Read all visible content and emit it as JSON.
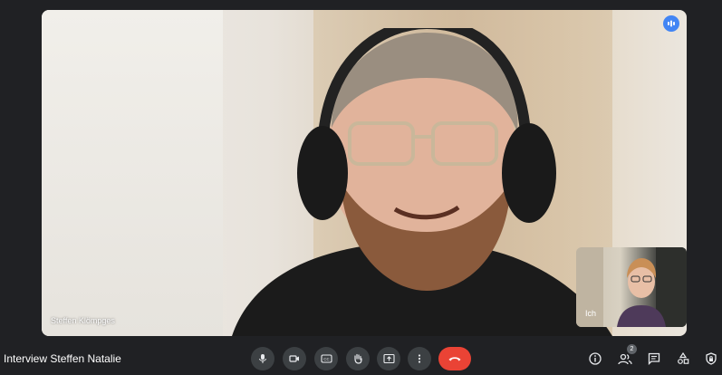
{
  "meeting": {
    "title": "Interview Steffen Natalie"
  },
  "main_tile": {
    "participant_name": "Steffen Klömpges",
    "speaking_indicator": "audio-level-icon"
  },
  "self_tile": {
    "label": "Ich"
  },
  "controls": [
    {
      "name": "microphone",
      "icon": "mic-icon"
    },
    {
      "name": "camera",
      "icon": "camera-icon"
    },
    {
      "name": "captions",
      "icon": "cc-icon"
    },
    {
      "name": "raise-hand",
      "icon": "hand-icon"
    },
    {
      "name": "present",
      "icon": "present-icon"
    },
    {
      "name": "more-options",
      "icon": "more-vert-icon"
    },
    {
      "name": "leave-call",
      "icon": "hangup-icon"
    }
  ],
  "side_controls": {
    "participants_count": "2"
  },
  "colors": {
    "background": "#202124",
    "button": "#3c4043",
    "end_call": "#ea4335",
    "accent": "#4285f4"
  }
}
